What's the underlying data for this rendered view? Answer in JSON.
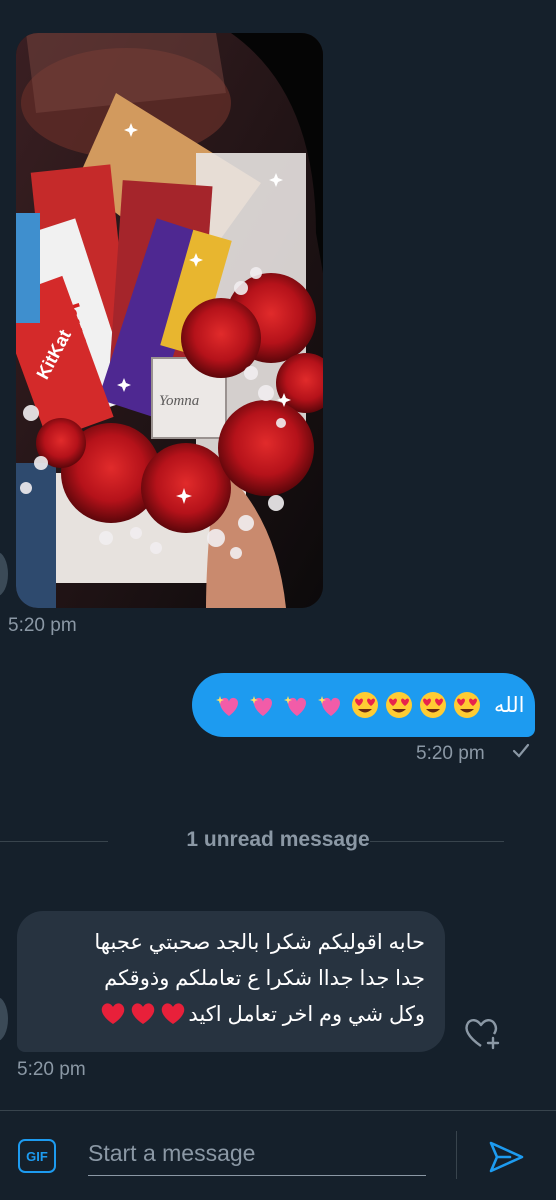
{
  "image_message": {
    "timestamp": "5:20 pm"
  },
  "outgoing_message": {
    "text": "الله",
    "emojis": [
      "sparkling-heart-icon",
      "sparkling-heart-icon",
      "sparkling-heart-icon",
      "sparkling-heart-icon",
      "heart-eyes-icon",
      "heart-eyes-icon",
      "heart-eyes-icon",
      "heart-eyes-icon"
    ],
    "timestamp": "5:20 pm",
    "status_icon": "checkmark-icon"
  },
  "divider": {
    "label": "1 unread message"
  },
  "incoming_message": {
    "lines": [
      "حابه اقوليكم شكرا بالجد صحبتي عجبها",
      "جدا جدا جداا شكرا ع تعاملكم وذوقكم",
      "وكل شي وم اخر تعامل اكيد"
    ],
    "trailing_emojis": [
      "red-heart-icon",
      "red-heart-icon",
      "red-heart-icon"
    ],
    "timestamp": "5:20 pm"
  },
  "composer": {
    "gif_label": "GIF",
    "placeholder": "Start a message",
    "send_icon": "send-icon"
  },
  "colors": {
    "background": "#15202b",
    "accent": "#1d9bf0",
    "incoming_bubble": "#273340",
    "muted_text": "#8b98a5"
  }
}
